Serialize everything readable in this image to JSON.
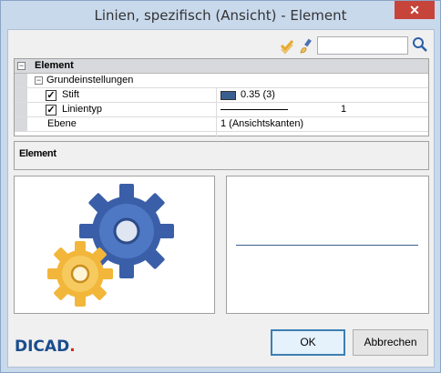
{
  "window": {
    "title": "Linien, spezifisch (Ansicht)  - Element",
    "close_glyph": "✕"
  },
  "toolbar": {
    "icons": [
      "check-all-icon",
      "brush-icon"
    ],
    "search_value": "",
    "search_icon": "magnifier-icon"
  },
  "grid": {
    "header": "Element",
    "group": "Grundeinstellungen",
    "rows": [
      {
        "name": "Stift",
        "checked": true,
        "value": "0.35 (3)",
        "swatch_color": "#3a5f8f"
      },
      {
        "name": "Linientyp",
        "checked": true,
        "value": "1"
      },
      {
        "name": "Ebene",
        "checked": null,
        "value": "1 (Ansichtskanten)"
      }
    ]
  },
  "description": {
    "title": "Element"
  },
  "preview": {
    "line_color": "#3a5f8f"
  },
  "brand": {
    "logo_text": "DICAD"
  },
  "buttons": {
    "ok": "OK",
    "cancel": "Abbrechen"
  },
  "colors": {
    "gear_blue": "#3a5fa8",
    "gear_yellow": "#f2c14e",
    "window_frame": "#c9d9ec",
    "close_red": "#c7443a"
  }
}
